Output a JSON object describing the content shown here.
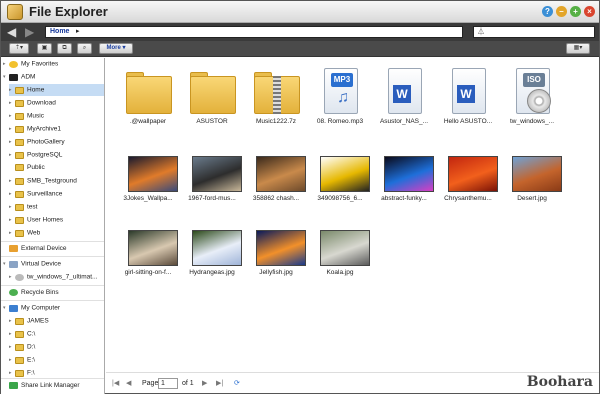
{
  "window": {
    "title": "File Explorer"
  },
  "address": {
    "path": "Home",
    "filter_placeholder": ""
  },
  "toolbar": {
    "more_label": "More"
  },
  "sidebar": {
    "favorites": "My Favorites",
    "user": "ADM",
    "home_folders": [
      "Home",
      "Download",
      "Music",
      "MyArchive1",
      "PhotoGallery",
      "PostgreSQL",
      "Public",
      "SMB_Testground",
      "Surveillance",
      "test",
      "User Homes",
      "Web"
    ],
    "external": "External Device",
    "virtual": "Virtual Device",
    "virtual_items": [
      "tw_windows_7_ultimat..."
    ],
    "recycle": "Recycle Bins",
    "computer": "My Computer",
    "computer_items": [
      "JAMES",
      "C:\\",
      "D:\\",
      "E:\\",
      "F:\\"
    ],
    "share": "Share Link Manager"
  },
  "files": [
    {
      "name": ".@wallpaper",
      "type": "folder"
    },
    {
      "name": "ASUSTOR",
      "type": "folder"
    },
    {
      "name": "Music1222.7z",
      "type": "zip"
    },
    {
      "name": "08. Romeo.mp3",
      "type": "mp3",
      "badge": "MP3"
    },
    {
      "name": "Asustor_NAS_...",
      "type": "word"
    },
    {
      "name": "Hello ASUSTO...",
      "type": "word"
    },
    {
      "name": "tw_windows_...",
      "type": "iso",
      "badge": "ISO"
    },
    {
      "name": "3Jokes_Wallpa...",
      "type": "image",
      "colors": [
        "#1a1a2e",
        "#e07b2a",
        "#3a4a7a"
      ]
    },
    {
      "name": "1967-ford-mus...",
      "type": "image",
      "colors": [
        "#6a7b8c",
        "#2d2d2d",
        "#c9b89a"
      ]
    },
    {
      "name": "358862 chash...",
      "type": "image",
      "colors": [
        "#3b2a1c",
        "#c98a4b",
        "#6d4a2b"
      ]
    },
    {
      "name": "349098756_6...",
      "type": "image",
      "colors": [
        "#ffffff",
        "#e6b800",
        "#222222"
      ]
    },
    {
      "name": "abstract-funky...",
      "type": "image",
      "colors": [
        "#0a0a1a",
        "#1e6fd9",
        "#d93ec4"
      ]
    },
    {
      "name": "Chrysanthemu...",
      "type": "image",
      "colors": [
        "#c2260f",
        "#f2601c",
        "#7a1206"
      ]
    },
    {
      "name": "Desert.jpg",
      "type": "image",
      "colors": [
        "#6fa2d6",
        "#c4642c",
        "#8a3a16"
      ]
    },
    {
      "name": "girl-sitting-on-f...",
      "type": "image",
      "colors": [
        "#2b3a2a",
        "#d8c8b0",
        "#5a4a3a"
      ]
    },
    {
      "name": "Hydrangeas.jpg",
      "type": "image",
      "colors": [
        "#2c4a1a",
        "#e8eef8",
        "#9fb4d8"
      ]
    },
    {
      "name": "Jellyfish.jpg",
      "type": "image",
      "colors": [
        "#0a1a5a",
        "#f2902a",
        "#1a3a8a"
      ]
    },
    {
      "name": "Koala.jpg",
      "type": "image",
      "colors": [
        "#7a8a6a",
        "#d8d8d0",
        "#5a5a5a"
      ]
    }
  ],
  "pager": {
    "page_label": "Page",
    "page_value": "1",
    "of_label": "of 1"
  },
  "watermark": "Boohara"
}
